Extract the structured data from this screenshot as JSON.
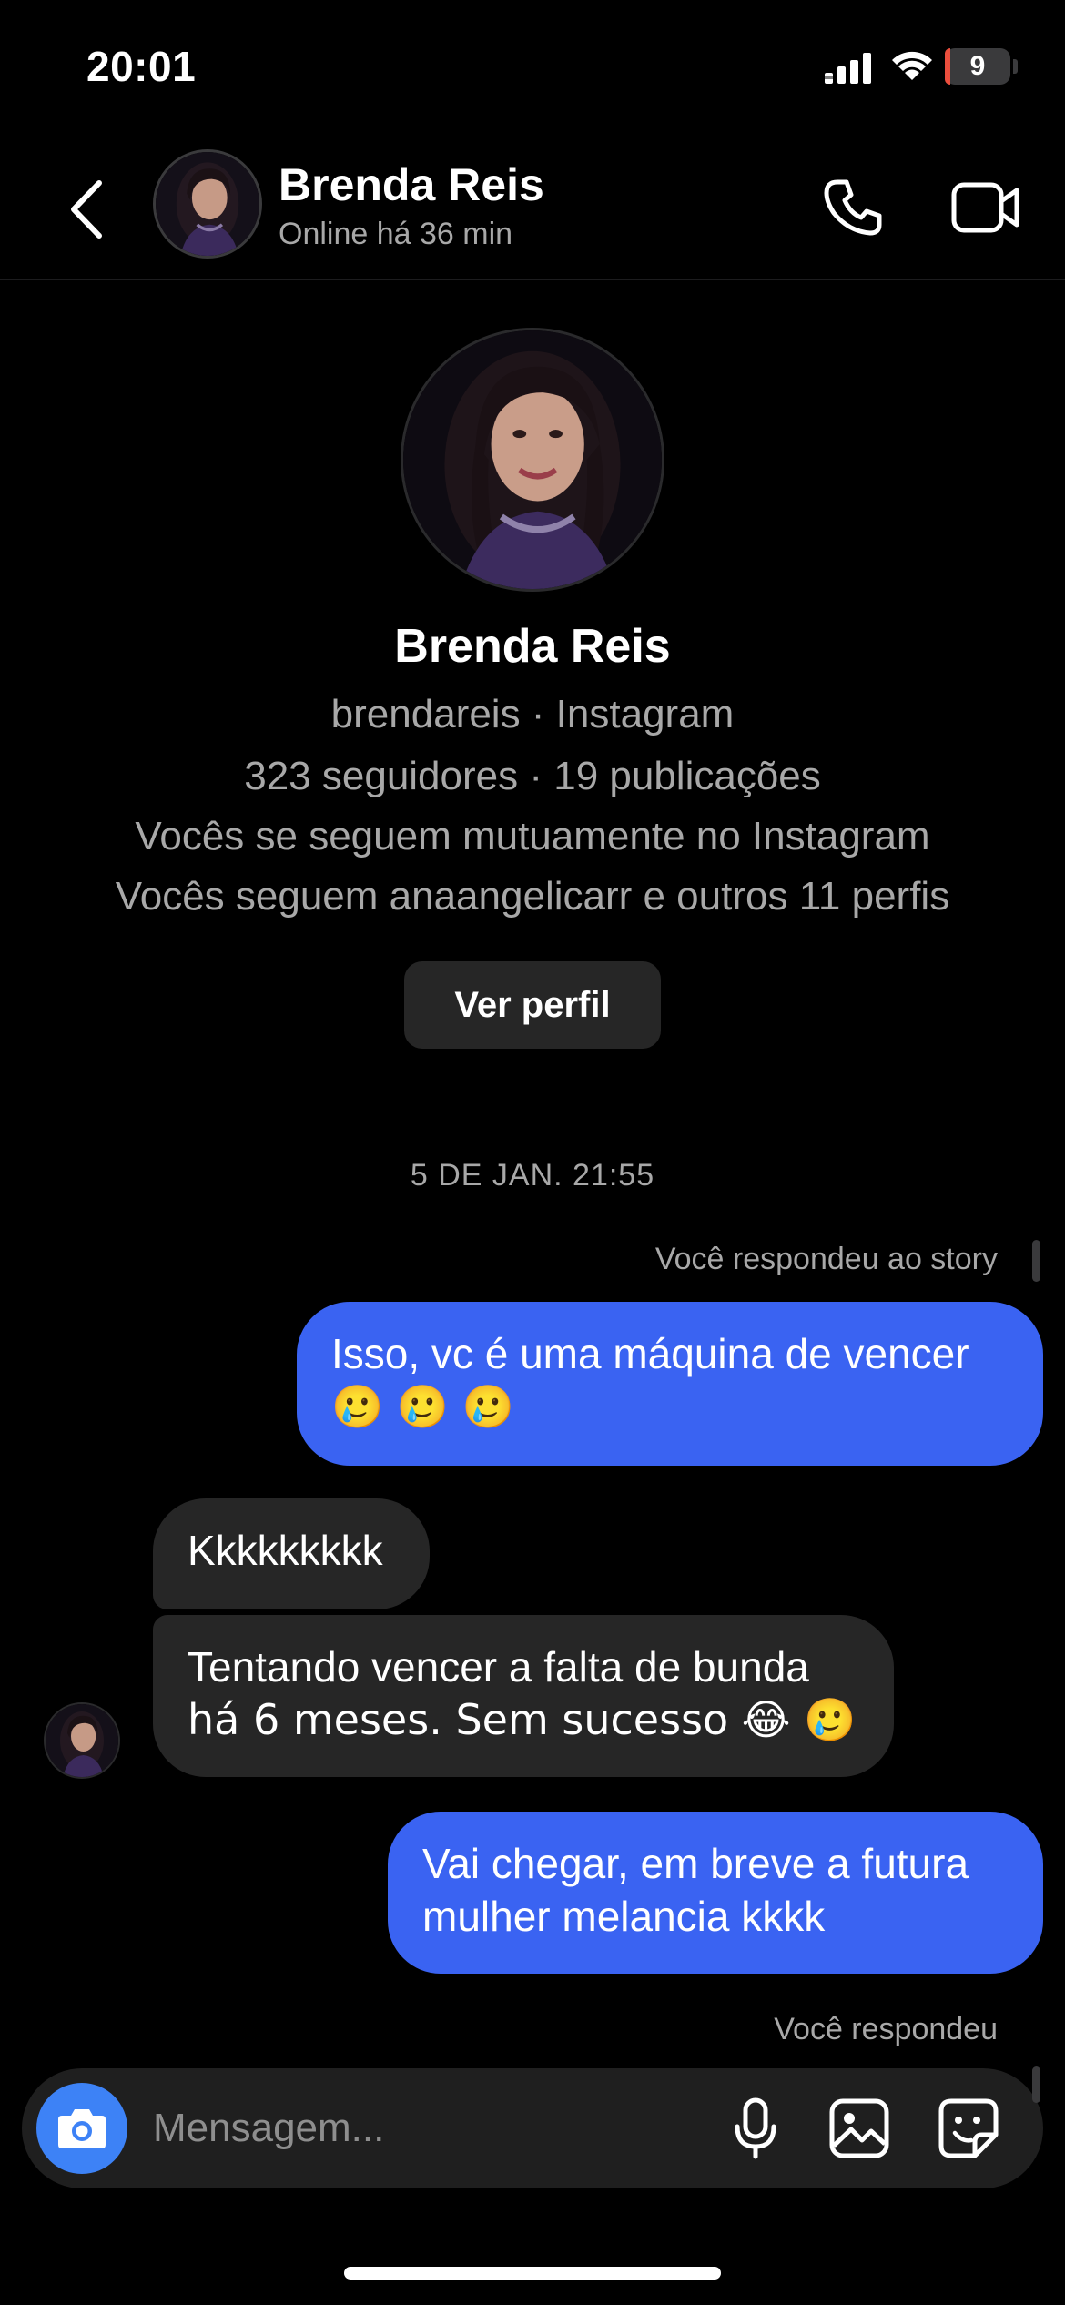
{
  "status_bar": {
    "time": "20:01",
    "battery_level": "9",
    "battery_percent": 9,
    "battery_color": "#eb4e3d",
    "icons": [
      "cellular-signal-icon",
      "wifi-icon",
      "battery-icon"
    ]
  },
  "header": {
    "name": "Brenda Reis",
    "status": "Online há 36 min",
    "icons": [
      "chevron-left-icon",
      "phone-icon",
      "video-camera-icon"
    ]
  },
  "profile": {
    "name": "Brenda Reis",
    "handle_line": "brendareis · Instagram",
    "stats_line": "323 seguidores · 19 publicações",
    "mutual_line": "Vocês se seguem mutuamente no Instagram",
    "followers_line": "Vocês seguem anaangelicarr e outros 11 perfis",
    "button_label": "Ver perfil"
  },
  "conversation": {
    "timestamp": "5 DE JAN. 21:55",
    "story_reply_label": "Você respondeu ao story",
    "messages": [
      {
        "from": "me",
        "line1": "Isso, vc é uma máquina de vencer",
        "line2": "🥲 🥲 🥲"
      },
      {
        "from": "them",
        "text": "Kkkkkkkkk"
      },
      {
        "from": "them",
        "line1": "Tentando vencer a falta de bunda",
        "line2": "há 6 meses. Sem sucesso 😂 🥲"
      },
      {
        "from": "me",
        "line1": "Vai chegar, em breve a futura",
        "line2": "mulher melancia kkkk"
      }
    ],
    "reply_label": "Você respondeu"
  },
  "composer": {
    "placeholder": "Mensagem...",
    "icons": [
      "camera-icon",
      "microphone-icon",
      "gallery-icon",
      "sticker-icon"
    ],
    "accent": "#3d82f6"
  },
  "colors": {
    "outgoing_bubble": "#3a63f2",
    "incoming_bubble": "#262626",
    "secondary_text": "#a8a8a8"
  }
}
